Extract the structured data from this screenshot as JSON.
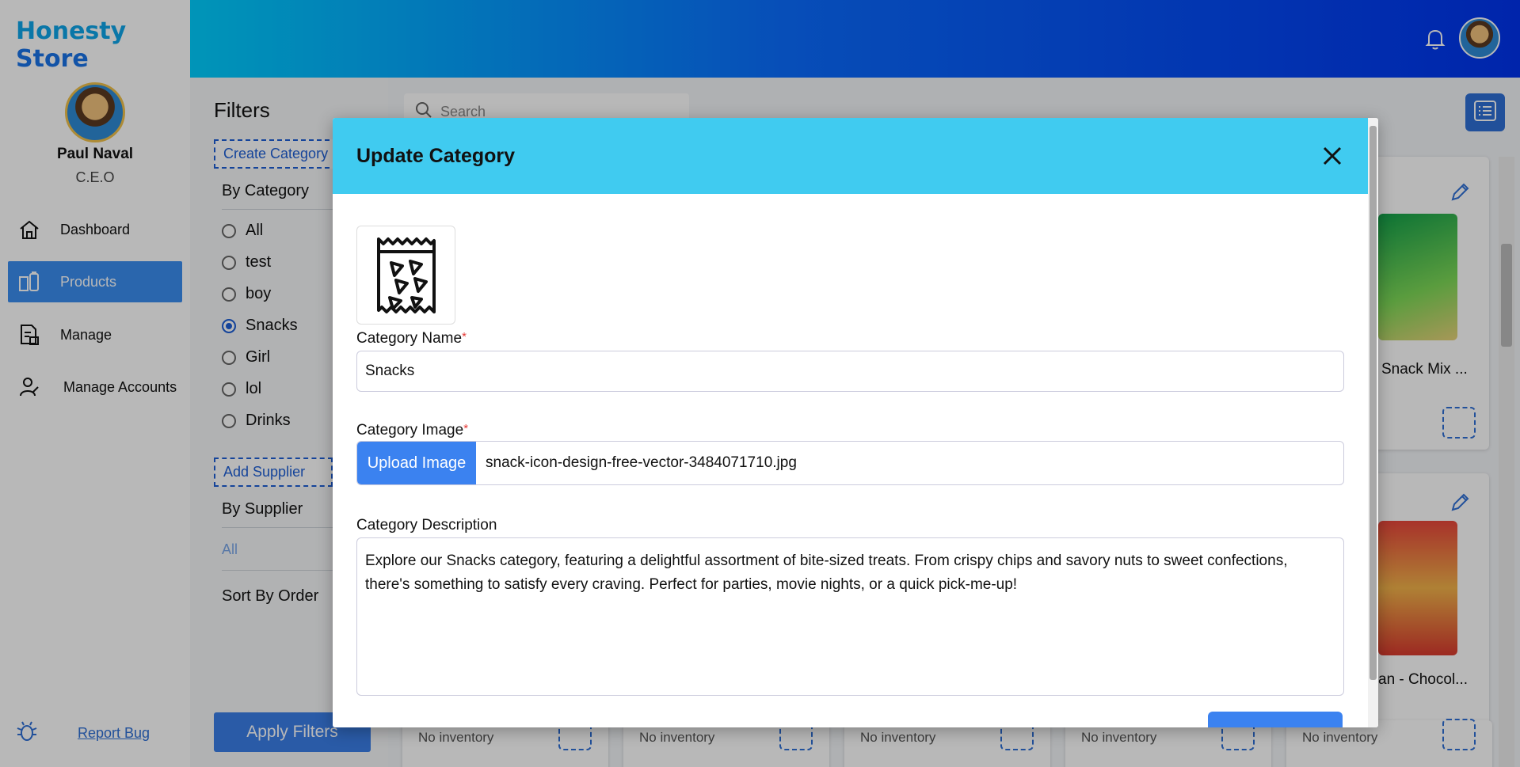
{
  "brand": {
    "word1": "Honesty",
    "word2": "Store"
  },
  "user": {
    "name": "Paul Naval",
    "role": "C.E.O"
  },
  "nav": [
    {
      "label": "Dashboard",
      "icon": "home-icon"
    },
    {
      "label": "Products",
      "icon": "products-icon",
      "active": true
    },
    {
      "label": "Manage",
      "icon": "manage-icon"
    },
    {
      "label": "Manage Accounts",
      "icon": "accounts-icon"
    }
  ],
  "report": {
    "label": "Report Bug"
  },
  "filters": {
    "title": "Filters",
    "create_category": "Create Category",
    "by_category": "By Category",
    "categories": [
      "All",
      "test",
      "boy",
      "Snacks",
      "Girl",
      "lol",
      "Drinks"
    ],
    "selected_category": "Snacks",
    "add_supplier": "Add Supplier",
    "by_supplier": "By Supplier",
    "supplier_all": "All",
    "sort_by": "Sort By Order",
    "apply": "Apply Filters"
  },
  "search": {
    "placeholder": "Search"
  },
  "products": {
    "names": [
      "Snack Mix ...",
      "an - Chocol..."
    ],
    "no_inventory": "No inventory"
  },
  "modal": {
    "title": "Update Category",
    "name_label": "Category Name",
    "name_value": "Snacks",
    "image_label": "Category Image",
    "upload_label": "Upload Image",
    "file_name": "snack-icon-design-free-vector-3484071710.jpg",
    "desc_label": "Category Description",
    "desc_value": "Explore our Snacks category, featuring a delightful assortment of bite-sized treats. From crispy chips and savory nuts to sweet confections, there's something to satisfy every craving. Perfect for parties, movie nights, or a quick pick-me-up!",
    "required_mark": "*"
  },
  "colors": {
    "accent": "#3b82f0",
    "header_start": "#00cfff",
    "header_end": "#0033ee",
    "modal_head": "#40cbf0"
  }
}
